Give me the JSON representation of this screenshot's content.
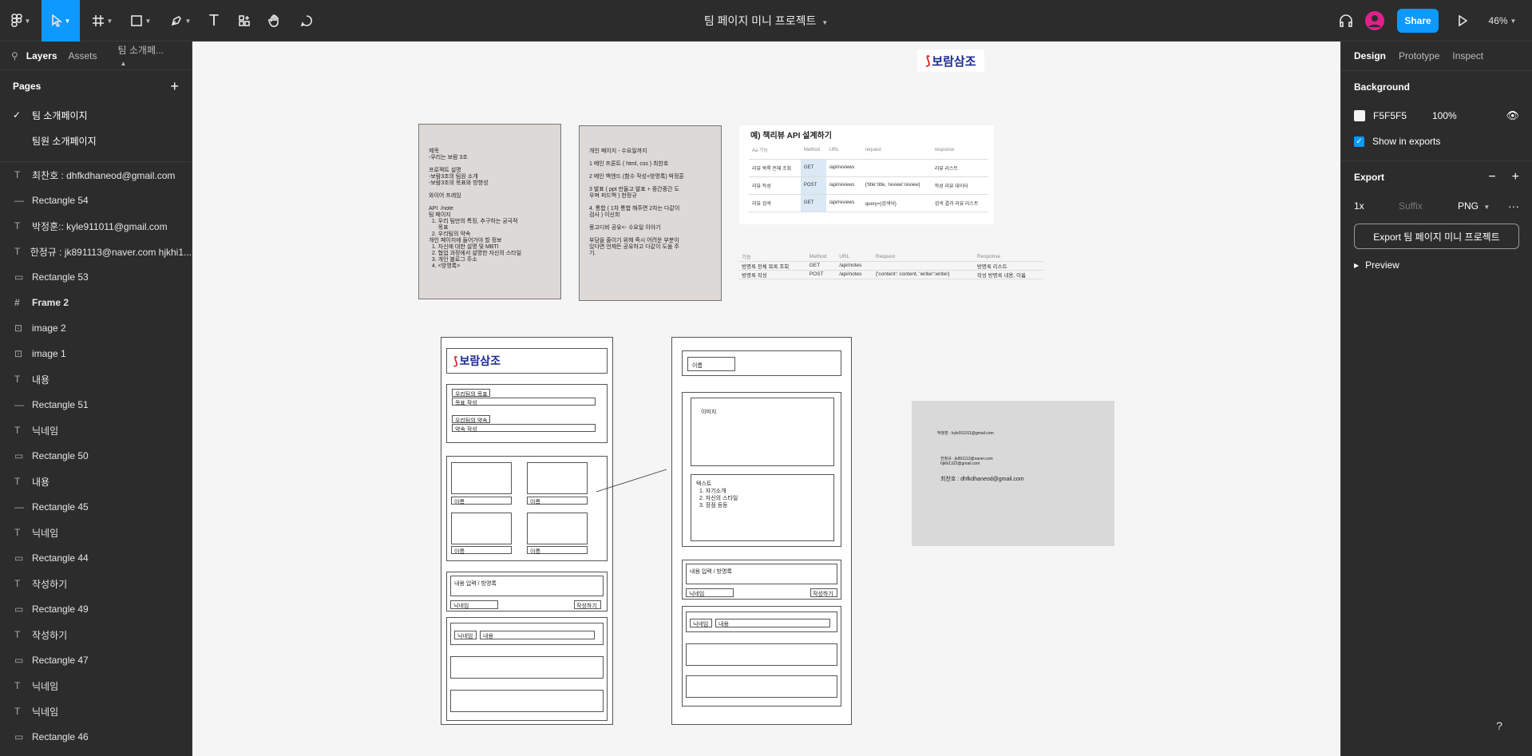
{
  "toolbar": {
    "title": "팀 페이지 미니 프로젝트",
    "share": "Share",
    "zoom": "46%",
    "avatar_color": "#e0218a"
  },
  "left": {
    "tabs": [
      "Layers",
      "Assets",
      "팀 소개페..."
    ],
    "pages_label": "Pages",
    "pages": [
      {
        "label": "팀 소개페이지",
        "current": true
      },
      {
        "label": "팀원 소개페이지",
        "current": false
      }
    ],
    "layers": [
      {
        "icon": "text",
        "label": "최찬호 : dhfkdhaneod@gmail.com"
      },
      {
        "icon": "line",
        "label": "Rectangle 54"
      },
      {
        "icon": "text",
        "label": "박정훈:: kyle911011@gmail.com"
      },
      {
        "icon": "text",
        "label": "한정규 : jk891113@naver.com hjkhi1..."
      },
      {
        "icon": "rect",
        "label": "Rectangle 53"
      },
      {
        "icon": "frame",
        "label": "Frame 2"
      },
      {
        "icon": "image",
        "label": "image 2"
      },
      {
        "icon": "image",
        "label": "image 1"
      },
      {
        "icon": "text",
        "label": "내용"
      },
      {
        "icon": "line",
        "label": "Rectangle 51"
      },
      {
        "icon": "text",
        "label": "닉네임"
      },
      {
        "icon": "rect",
        "label": "Rectangle 50"
      },
      {
        "icon": "text",
        "label": "내용"
      },
      {
        "icon": "line",
        "label": "Rectangle 45"
      },
      {
        "icon": "text",
        "label": "닉네임"
      },
      {
        "icon": "rect",
        "label": "Rectangle 44"
      },
      {
        "icon": "text",
        "label": "작성하기"
      },
      {
        "icon": "rect",
        "label": "Rectangle 49"
      },
      {
        "icon": "text",
        "label": "작성하기"
      },
      {
        "icon": "rect",
        "label": "Rectangle 47"
      },
      {
        "icon": "text",
        "label": "닉네임"
      },
      {
        "icon": "text",
        "label": "닉네임"
      },
      {
        "icon": "rect",
        "label": "Rectangle 46"
      }
    ]
  },
  "canvas": {
    "bg": "#F5F5F5",
    "logo_text": "보람삼조",
    "note1": "제목\n-우리는 보람 3조\n\n프로젝트 설명\n-보람3조의 팀원 소개\n-보람3조의 목표와 방향성\n\n와이어 프레임\n\nAPI  /note\n팀 페이지\n  1. 우리 팀만의 특징, 추구하는 궁극적\n      목표\n  2. 우리팀의 약속\n개인 페이지에 들어가야 할 정보\n  1. 자신에 대한 설명 및 MBTI\n  2. 협업 과정에서 설명한 자신의 스타일\n  3. 개인 블로그 주소\n  4. <방명록>",
    "note2": "개인 페이지 - 수요일까지\n\n1 메인 프론트 ( html, css ) 최찬호\n\n2 메인 백엔드 (함수 작성+방명록) 박정훈\n\n3 발표 ( ppt 만들고 발표 + 중간중간 도\n우며 피드백 ) 한정규\n\n4. 통합 ( 1차 통합 해주면 2차는 다같이\n검사 ) 이신희\n\n몽고디비 공유<- 수요일 이야기\n\n부담을 줄이기 위해 즉시 어려운 부분이\n있다면 언제든 공유하고 다같이 도움 주\n기.",
    "api_title": "예) 책리뷰 API 설계하기",
    "api_headers": [
      "Aa 기능",
      "Method",
      "URL",
      "request",
      "response"
    ],
    "api_rows": [
      [
        "리뷰 목록 전체 조회",
        "GET",
        "/api/reviews",
        "",
        "리뷰 리스트"
      ],
      [
        "리뷰 작성",
        "POST",
        "/api/reviews",
        "{'title':title, 'review':review}",
        "작성 리뷰 데이터"
      ],
      [
        "리뷰 검색",
        "GET",
        "/api/reviews",
        "query={검색어}",
        "검색 결과 리뷰 리스트"
      ]
    ],
    "small_headers": [
      "기능",
      "Method",
      "URL",
      "Request",
      "Response"
    ],
    "small_rows": [
      [
        "방명록 전체 목록 조회",
        "GET",
        "/api/notes",
        "",
        "방명록 리스트"
      ],
      [
        "방명록 작성",
        "POST",
        "/api/notes",
        "{'content': content, 'writer':writer}",
        "작성 방명록 내용, 이름"
      ]
    ],
    "wf1": {
      "goal": "우리팀의 목표",
      "goal_write": "목표 작성",
      "promise": "우리팀의 약속",
      "promise_write": "약속 작성",
      "name": "이름",
      "guestbook": "내용 입력 / 방명록",
      "nickname": "닉네임",
      "write": "작성하기",
      "content": "내용"
    },
    "wf2": {
      "name": "이름",
      "image": "이미지",
      "text_title": "텍스트",
      "text_items": [
        "1. 자기소개",
        "2. 자신의 스타일",
        "3. 장점 등등"
      ],
      "guestbook": "내용 입력 / 방명록",
      "nickname": "닉네임",
      "write": "작성하기",
      "content": "내용"
    },
    "contacts": {
      "a": "박정훈 : kyle911011@gmail.com",
      "b1": "한정규 : jk891113@naver.com",
      "b2": "hjkhi1322@gmail.com",
      "c": "최찬호 : dhfkdhaneod@gmail.com"
    }
  },
  "right": {
    "tabs": [
      "Design",
      "Prototype",
      "Inspect"
    ],
    "background": "Background",
    "bg_hex": "F5F5F5",
    "bg_opacity": "100%",
    "show_in_exports": "Show in exports",
    "export": "Export",
    "scale": "1x",
    "suffix": "Suffix",
    "format": "PNG",
    "export_button": "Export 팀 페이지 미니 프로젝트",
    "preview": "Preview"
  },
  "help": "?"
}
